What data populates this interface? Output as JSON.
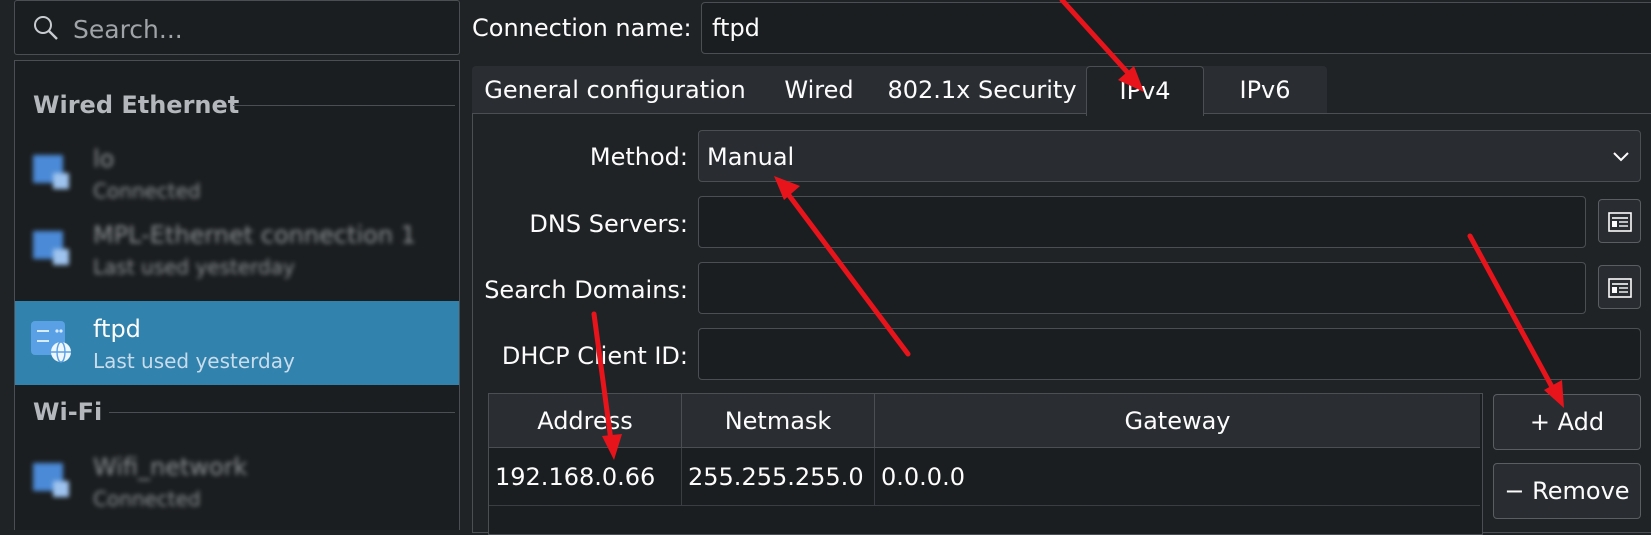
{
  "search": {
    "placeholder": "Search..."
  },
  "sidebar": {
    "sections": [
      {
        "title": "Wired Ethernet"
      },
      {
        "title": "Wi-Fi"
      }
    ],
    "items": [
      {
        "name": "lo",
        "subtitle": "Connected"
      },
      {
        "name": "MPL-Ethernet connection 1",
        "subtitle": "Last used yesterday"
      },
      {
        "name": "ftpd",
        "subtitle": "Last used yesterday"
      },
      {
        "name": "Wifi_network",
        "subtitle": "Connected"
      }
    ]
  },
  "editor": {
    "connection_name_label": "Connection name:",
    "connection_name_value": "ftpd",
    "tabs": [
      {
        "label": "General configuration"
      },
      {
        "label": "Wired"
      },
      {
        "label": "802.1x Security"
      },
      {
        "label": "IPv4",
        "active": true
      },
      {
        "label": "IPv6"
      }
    ],
    "method_label": "Method:",
    "method_value": "Manual",
    "dns_label": "DNS Servers:",
    "dns_value": "",
    "search_domains_label": "Search Domains:",
    "search_domains_value": "",
    "dhcp_label": "DHCP Client ID:",
    "dhcp_value": "",
    "table": {
      "columns": [
        "Address",
        "Netmask",
        "Gateway"
      ],
      "rows": [
        [
          "192.168.0.66",
          "255.255.255.0",
          "0.0.0.0"
        ]
      ]
    },
    "add_button": "+ Add",
    "remove_button": "− Remove"
  },
  "colors": {
    "background": "#202326",
    "selection": "#3182ad",
    "annotation": "#e8141c"
  }
}
